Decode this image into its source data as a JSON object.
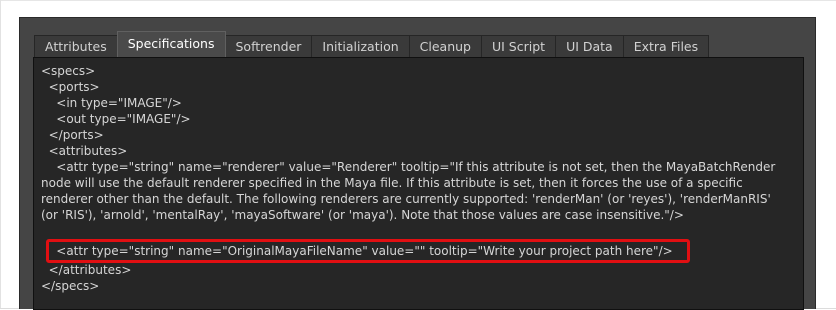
{
  "tabs": [
    {
      "label": "Attributes",
      "active": false
    },
    {
      "label": "Specifications",
      "active": true
    },
    {
      "label": "Softrender",
      "active": false
    },
    {
      "label": "Initialization",
      "active": false
    },
    {
      "label": "Cleanup",
      "active": false
    },
    {
      "label": "UI Script",
      "active": false
    },
    {
      "label": "UI Data",
      "active": false
    },
    {
      "label": "Extra Files",
      "active": false
    }
  ],
  "code": {
    "lines": [
      "<specs>",
      "  <ports>",
      "    <in type=\"IMAGE\"/>",
      "    <out type=\"IMAGE\"/>",
      "  </ports>",
      "  <attributes>",
      "    <attr type=\"string\" name=\"renderer\" value=\"Renderer\" tooltip=\"If this attribute is not set, then the MayaBatchRender",
      "node will use the default renderer specified in the Maya file. If this attribute is set, then it forces the use of a specific",
      "renderer other than the default. The following renderers are currently supported: 'renderMan' (or 'reyes'), 'renderManRIS'",
      "(or 'RIS'), 'arnold', 'mentalRay', 'mayaSoftware' (or 'maya'). Note that those values are case insensitive.\"/>",
      "    <attr type=\"string\" name=\"OriginalMayaFileName\" value=\"\" tooltip=\"Write your project path here\"/>",
      "  </attributes>",
      "</specs>"
    ]
  },
  "colors": {
    "panel_bg": "#454545",
    "editor_bg": "#262626",
    "highlight_border": "#e10f12",
    "text": "#d6d6d6"
  }
}
